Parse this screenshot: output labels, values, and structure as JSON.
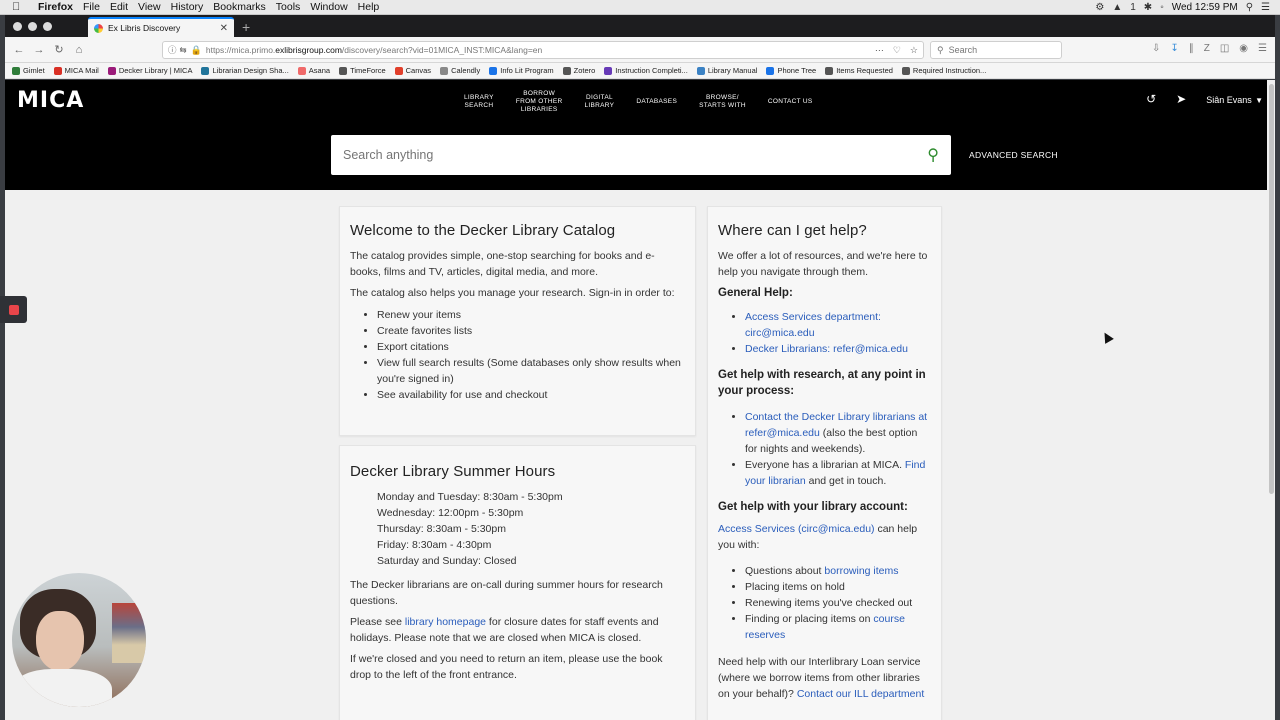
{
  "menubar": {
    "app": "Firefox",
    "items": [
      "File",
      "Edit",
      "View",
      "History",
      "Bookmarks",
      "Tools",
      "Window",
      "Help"
    ],
    "clock": "Wed 12:59 PM",
    "battery_digit": "1"
  },
  "browser": {
    "tab_title": "Ex Libris Discovery",
    "url_host": "https://mica.primo.",
    "url_domain": "exlibrisgroup.com",
    "url_path": "/discovery/search?vid=01MICA_INST:MICA&lang=en",
    "search_placeholder": "Search"
  },
  "bookmarks": [
    {
      "label": "Gimlet",
      "color": "#2f7d3a"
    },
    {
      "label": "MICA Mail",
      "color": "#d93025"
    },
    {
      "label": "Decker Library | MICA",
      "color": "#9b1b7a"
    },
    {
      "label": "Librarian Design Sha...",
      "color": "#21759b"
    },
    {
      "label": "Asana",
      "color": "#f06a6a"
    },
    {
      "label": "TimeForce",
      "color": "#555555"
    },
    {
      "label": "Canvas",
      "color": "#e13f2b"
    },
    {
      "label": "Calendly",
      "color": "#888888"
    },
    {
      "label": "Info Lit Program",
      "color": "#1a73e8"
    },
    {
      "label": "Zotero",
      "color": "#555555"
    },
    {
      "label": "Instruction Completi...",
      "color": "#673ab7"
    },
    {
      "label": "Library Manual",
      "color": "#3b82c4"
    },
    {
      "label": "Phone Tree",
      "color": "#1a73e8"
    },
    {
      "label": "Items Requested",
      "color": "#555555"
    },
    {
      "label": "Required Instruction...",
      "color": "#555555"
    }
  ],
  "site": {
    "logo": "MICA",
    "nav": [
      {
        "line1": "LIBRARY",
        "line2": "SEARCH",
        "line3": ""
      },
      {
        "line1": "BORROW",
        "line2": "FROM OTHER",
        "line3": "LIBRARIES"
      },
      {
        "line1": "DIGITAL",
        "line2": "LIBRARY",
        "line3": ""
      },
      {
        "line1": "DATABASES",
        "line2": "",
        "line3": ""
      },
      {
        "line1": "BROWSE/",
        "line2": "STARTS WITH",
        "line3": ""
      },
      {
        "line1": "CONTACT US",
        "line2": "",
        "line3": ""
      }
    ],
    "user_name": "Siân Evans",
    "search_placeholder": "Search anything",
    "advanced_search": "ADVANCED SEARCH"
  },
  "welcome": {
    "title": "Welcome to the Decker Library Catalog",
    "p1": "The catalog provides simple, one-stop searching for books and e-books, films and TV, articles, digital media, and more.",
    "p2": "The catalog also helps you manage your research. Sign-in in order to:",
    "items": [
      "Renew your items",
      "Create favorites lists",
      "Export citations",
      "View full search results (Some databases only show results when you're signed in)",
      "See availability for use and checkout"
    ]
  },
  "hours": {
    "title": "Decker Library Summer Hours",
    "lines": [
      "Monday and Tuesday: 8:30am - 5:30pm",
      "Wednesday: 12:00pm - 5:30pm",
      "Thursday: 8:30am - 5:30pm",
      "Friday: 8:30am - 4:30pm",
      "Saturday and Sunday: Closed"
    ],
    "p1": "The Decker librarians are on-call during summer hours for research questions.",
    "p2_pre": "Please see ",
    "p2_link": "library homepage",
    "p2_post": " for closure dates for staff events and holidays. Please note that we are closed when MICA is closed.",
    "p3": "If we're closed and you need to return an item, please use the book drop to the left of the front entrance."
  },
  "help": {
    "title": "Where can I get help?",
    "intro": "We offer a lot of resources, and we're here to help you navigate through them.",
    "general_heading": "General Help:",
    "general_1": "Access Services department: circ@mica.edu",
    "general_2": "Decker Librarians: refer@mica.edu",
    "research_heading": "Get help with research, at any point in your process:",
    "research_1_link": "Contact the Decker Library librarians at refer@mica.edu",
    "research_1_post": " (also the best option for nights and weekends).",
    "research_2_pre": "Everyone has a librarian at MICA. ",
    "research_2_link": "Find your librarian",
    "research_2_post": " and get in touch.",
    "account_heading": "Get help with your library account:",
    "account_link": "Access Services (circ@mica.edu)",
    "account_post": " can help you with:",
    "account_1_pre": "Questions about ",
    "account_1_link": "borrowing items",
    "account_2": "Placing items on hold",
    "account_3": "Renewing items you've checked out",
    "account_4_pre": "Finding or placing items on ",
    "account_4_link": "course reserves",
    "ill_pre": "Need help with our Interlibrary Loan service (where we borrow items from other libraries on your behalf)? ",
    "ill_link": "Contact our ILL department"
  }
}
